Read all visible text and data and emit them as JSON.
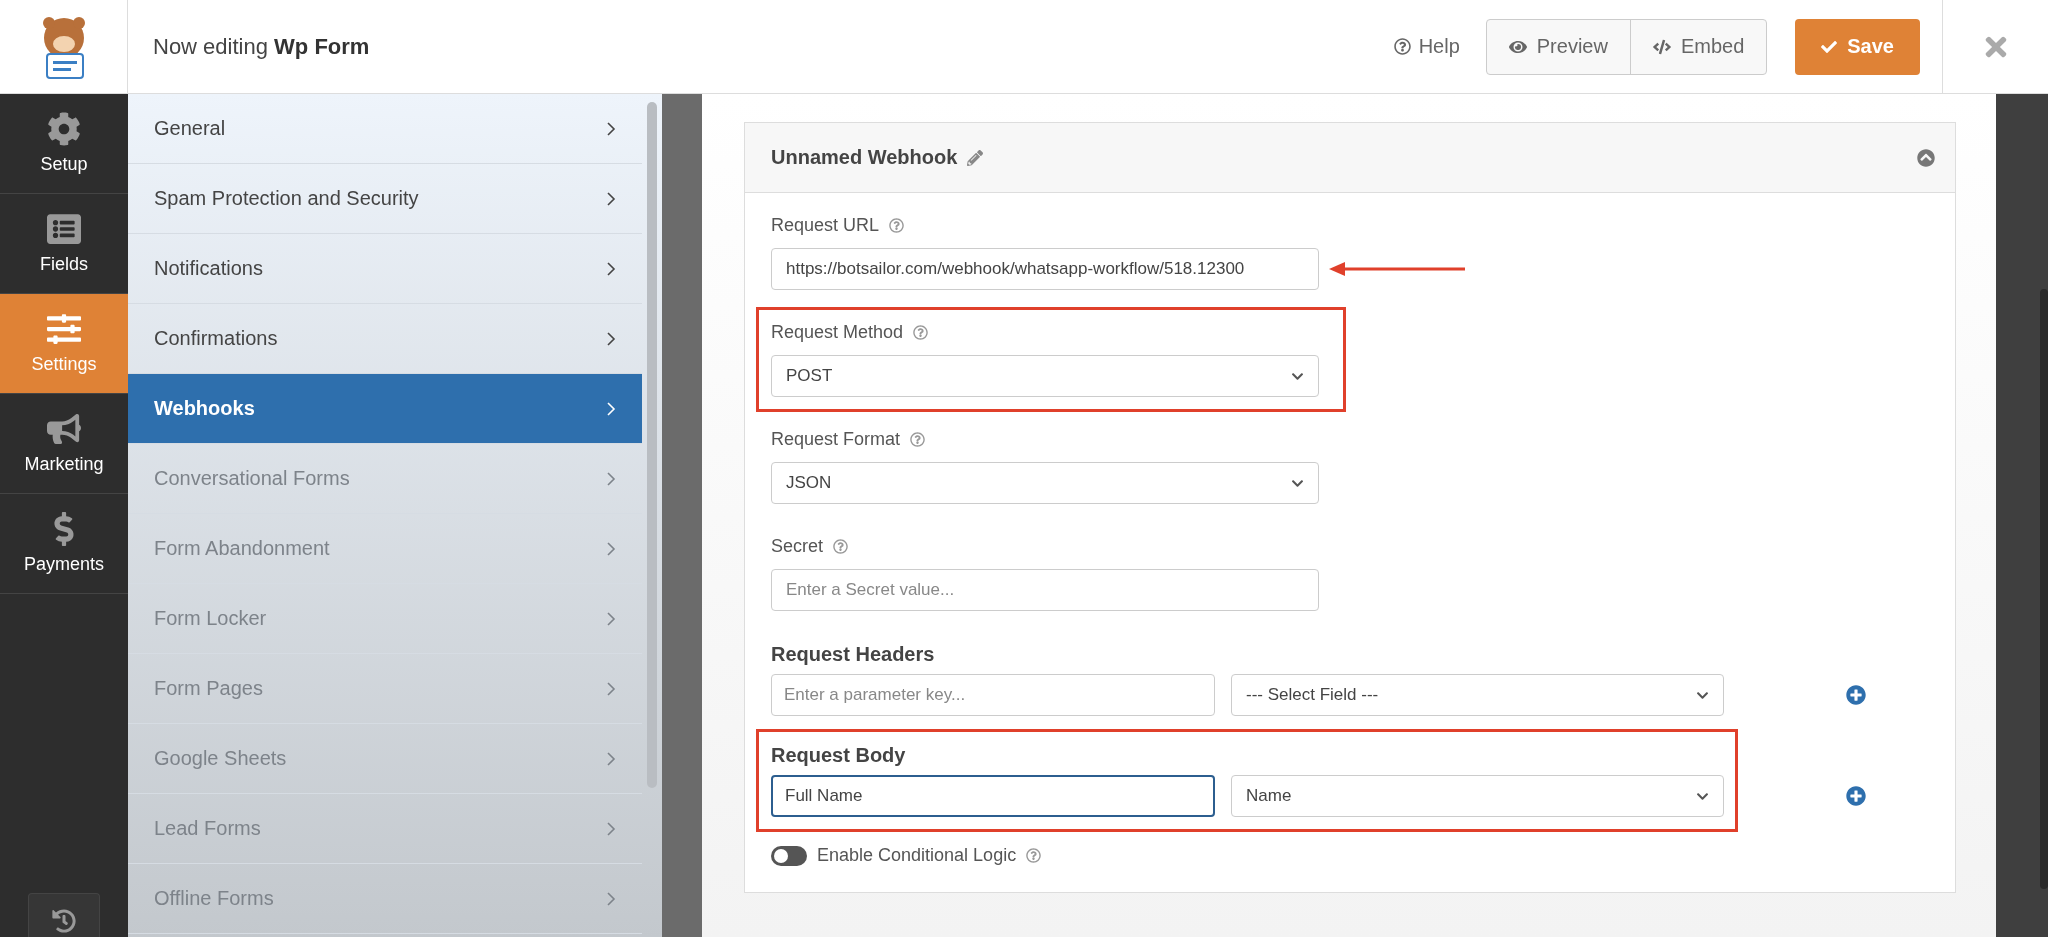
{
  "header": {
    "title_prefix": "Now editing",
    "form_name": "Wp Form",
    "help": "Help",
    "preview": "Preview",
    "embed": "Embed",
    "save": "Save"
  },
  "rail": [
    {
      "label": "Setup",
      "selected": false
    },
    {
      "label": "Fields",
      "selected": false
    },
    {
      "label": "Settings",
      "selected": true
    },
    {
      "label": "Marketing",
      "selected": false
    },
    {
      "label": "Payments",
      "selected": false
    }
  ],
  "settings_menu": [
    {
      "label": "General",
      "selected": false,
      "disabled": false
    },
    {
      "label": "Spam Protection and Security",
      "selected": false,
      "disabled": false
    },
    {
      "label": "Notifications",
      "selected": false,
      "disabled": false
    },
    {
      "label": "Confirmations",
      "selected": false,
      "disabled": false
    },
    {
      "label": "Webhooks",
      "selected": true,
      "disabled": false
    },
    {
      "label": "Conversational Forms",
      "selected": false,
      "disabled": true
    },
    {
      "label": "Form Abandonment",
      "selected": false,
      "disabled": true
    },
    {
      "label": "Form Locker",
      "selected": false,
      "disabled": true
    },
    {
      "label": "Form Pages",
      "selected": false,
      "disabled": true
    },
    {
      "label": "Google Sheets",
      "selected": false,
      "disabled": true
    },
    {
      "label": "Lead Forms",
      "selected": false,
      "disabled": true
    },
    {
      "label": "Offline Forms",
      "selected": false,
      "disabled": true
    }
  ],
  "webhook": {
    "title": "Unnamed Webhook",
    "expanded": true,
    "fields": [
      {
        "kind": "text",
        "label": "Request URL",
        "value": "https://botsailor.com/webhook/whatsapp-workflow/518.12300",
        "highlighted": false,
        "arrow": true
      },
      {
        "kind": "select",
        "label": "Request Method",
        "value": "POST",
        "highlighted": true,
        "arrow": false
      },
      {
        "kind": "select",
        "label": "Request Format",
        "value": "JSON",
        "highlighted": false,
        "arrow": false
      },
      {
        "kind": "text",
        "label": "Secret",
        "placeholder": "Enter a Secret value...",
        "highlighted": false,
        "arrow": false
      }
    ],
    "mappings": [
      {
        "title": "Request Headers",
        "key_placeholder": "Enter a parameter key...",
        "field": "--- Select Field ---",
        "highlighted": false,
        "focused": false
      },
      {
        "title": "Request Body",
        "key_value": "Full Name",
        "field": "Name",
        "highlighted": true,
        "focused": true
      }
    ],
    "conditional": {
      "label": "Enable Conditional Logic",
      "on": false
    }
  }
}
